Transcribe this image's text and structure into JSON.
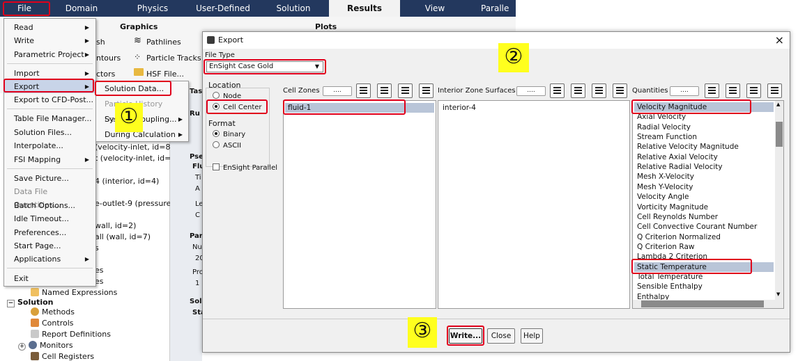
{
  "ribbon": {
    "tabs": [
      "File",
      "Domain",
      "Physics",
      "User-Defined",
      "Solution",
      "Results",
      "View",
      "Paralle"
    ],
    "active_tab": "Results",
    "graphics_label": "Graphics",
    "plots_label": "Plots",
    "graphics_items": [
      "sh",
      "ntours",
      "ctors"
    ],
    "right_items": [
      "Pathlines",
      "Particle Tracks",
      "HSF File..."
    ]
  },
  "file_menu": {
    "items": [
      {
        "label": "Read",
        "submenu": true
      },
      {
        "label": "Write",
        "submenu": true
      },
      {
        "label": "Parametric Project",
        "submenu": true
      },
      {
        "label": "Import",
        "submenu": true
      },
      {
        "label": "Export",
        "submenu": true
      },
      {
        "label": "Export to CFD-Post...",
        "submenu": false
      },
      {
        "label": "Table File Manager...",
        "submenu": false
      },
      {
        "label": "Solution Files...",
        "submenu": false
      },
      {
        "label": "Interpolate...",
        "submenu": false
      },
      {
        "label": "FSI Mapping",
        "submenu": true
      },
      {
        "label": "Save Picture...",
        "submenu": false
      },
      {
        "label": "Data File Quantities...",
        "submenu": false
      },
      {
        "label": "Batch Options...",
        "submenu": false
      },
      {
        "label": "Idle Timeout...",
        "submenu": false
      },
      {
        "label": "Preferences...",
        "submenu": false
      },
      {
        "label": "Start Page...",
        "submenu": false
      },
      {
        "label": "Applications",
        "submenu": true
      },
      {
        "label": "Exit",
        "submenu": false
      }
    ]
  },
  "export_submenu": {
    "items": [
      "Solution Data...",
      "Particle History Data...",
      "System Coupling...",
      "During Calculation"
    ]
  },
  "tree": {
    "items": [
      "(velocity-inlet, id=8)",
      "t (velocity-inlet, id=6)",
      "4 (interior, id=4)",
      "e-outlet-9 (pressure-ou",
      "wall, id=2)",
      "all (wall, id=7)",
      "s",
      "es",
      "es",
      "Named Expressions",
      "Solution",
      "Methods",
      "Controls",
      "Report Definitions",
      "Monitors",
      "Cell Registers"
    ],
    "mid_fragments": [
      "Tas",
      "Ru",
      "Pse",
      "Flu",
      "Ti",
      "A",
      "Le",
      "C",
      "Par",
      "Nu",
      "20",
      "Pro",
      "1",
      "Sol",
      "Sta"
    ]
  },
  "dialog": {
    "title": "Export",
    "close": "×",
    "file_type_label": "File Type",
    "file_type_value": "EnSight Case Gold",
    "location_label": "Location",
    "location_options": [
      "Node",
      "Cell Center"
    ],
    "location_selected": "Cell Center",
    "format_label": "Format",
    "format_options": [
      "Binary",
      "ASCII"
    ],
    "format_selected": "Binary",
    "parallel_label": "EnSight Parallel",
    "cell_zones_label": "Cell Zones",
    "cell_zones": [
      "fluid-1"
    ],
    "interior_label": "Interior Zone Surfaces",
    "interior_zones": [
      "interior-4"
    ],
    "quantities_label": "Quantities",
    "filter_placeholder": "....",
    "quantities": [
      "Velocity Magnitude",
      "Axial Velocity",
      "Radial Velocity",
      "Stream Function",
      "Relative Velocity Magnitude",
      "Relative Axial Velocity",
      "Relative Radial Velocity",
      "Mesh X-Velocity",
      "Mesh Y-Velocity",
      "Velocity Angle",
      "Vorticity Magnitude",
      "Cell Reynolds Number",
      "Cell Convective Courant Number",
      "Q Criterion Normalized",
      "Q Criterion Raw",
      "Lambda 2 Criterion",
      "Static Temperature",
      "Total Temperature",
      "Sensible Enthalpy",
      "Enthalpy"
    ],
    "selected_quantities": [
      "Velocity Magnitude",
      "Static Temperature"
    ],
    "buttons": {
      "write": "Write...",
      "close": "Close",
      "help": "Help"
    }
  },
  "callouts": [
    "①",
    "②",
    "③"
  ],
  "colors": {
    "ribbon": "#23385e",
    "highlight": "#e0001b",
    "badge": "#ffff1e",
    "selection": "#b9c5d8"
  }
}
